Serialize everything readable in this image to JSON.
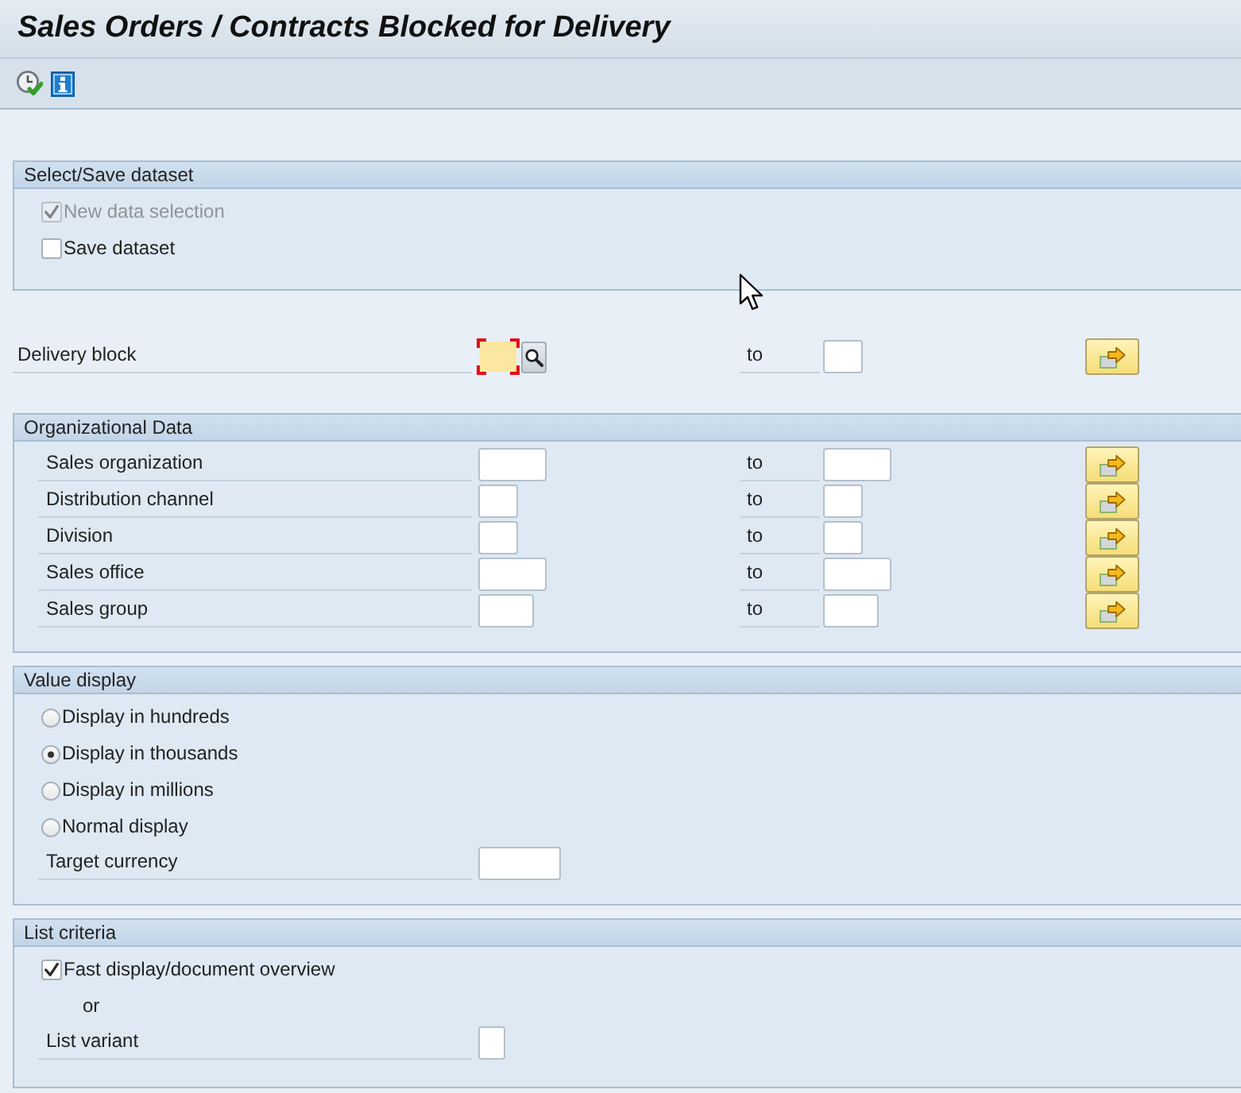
{
  "window": {
    "title": "Sales Orders / Contracts Blocked for Delivery"
  },
  "select_save_dataset": {
    "title": "Select/Save dataset",
    "options": [
      {
        "label": "New data selection",
        "checked": true,
        "disabled": true
      },
      {
        "label": "Save dataset",
        "checked": false,
        "disabled": false
      }
    ]
  },
  "delivery_block": {
    "label": "Delivery block",
    "to_label": "to",
    "focused": true
  },
  "organizational_data": {
    "title": "Organizational Data",
    "rows": [
      {
        "label": "Sales organization",
        "to_label": "to"
      },
      {
        "label": "Distribution channel",
        "to_label": "to"
      },
      {
        "label": "Division",
        "to_label": "to"
      },
      {
        "label": "Sales office",
        "to_label": "to"
      },
      {
        "label": "Sales group",
        "to_label": "to"
      }
    ]
  },
  "value_display": {
    "title": "Value display",
    "options": [
      {
        "label": "Display in hundreds",
        "selected": false
      },
      {
        "label": "Display in thousands",
        "selected": true
      },
      {
        "label": "Display in millions",
        "selected": false
      },
      {
        "label": "Normal display",
        "selected": false
      }
    ],
    "target_currency": {
      "label": "Target currency"
    }
  },
  "list_criteria": {
    "title": "List criteria",
    "fast_display": {
      "label": "Fast display/document overview",
      "checked": true
    },
    "separator": "or",
    "list_variant": {
      "label": "List variant"
    }
  }
}
